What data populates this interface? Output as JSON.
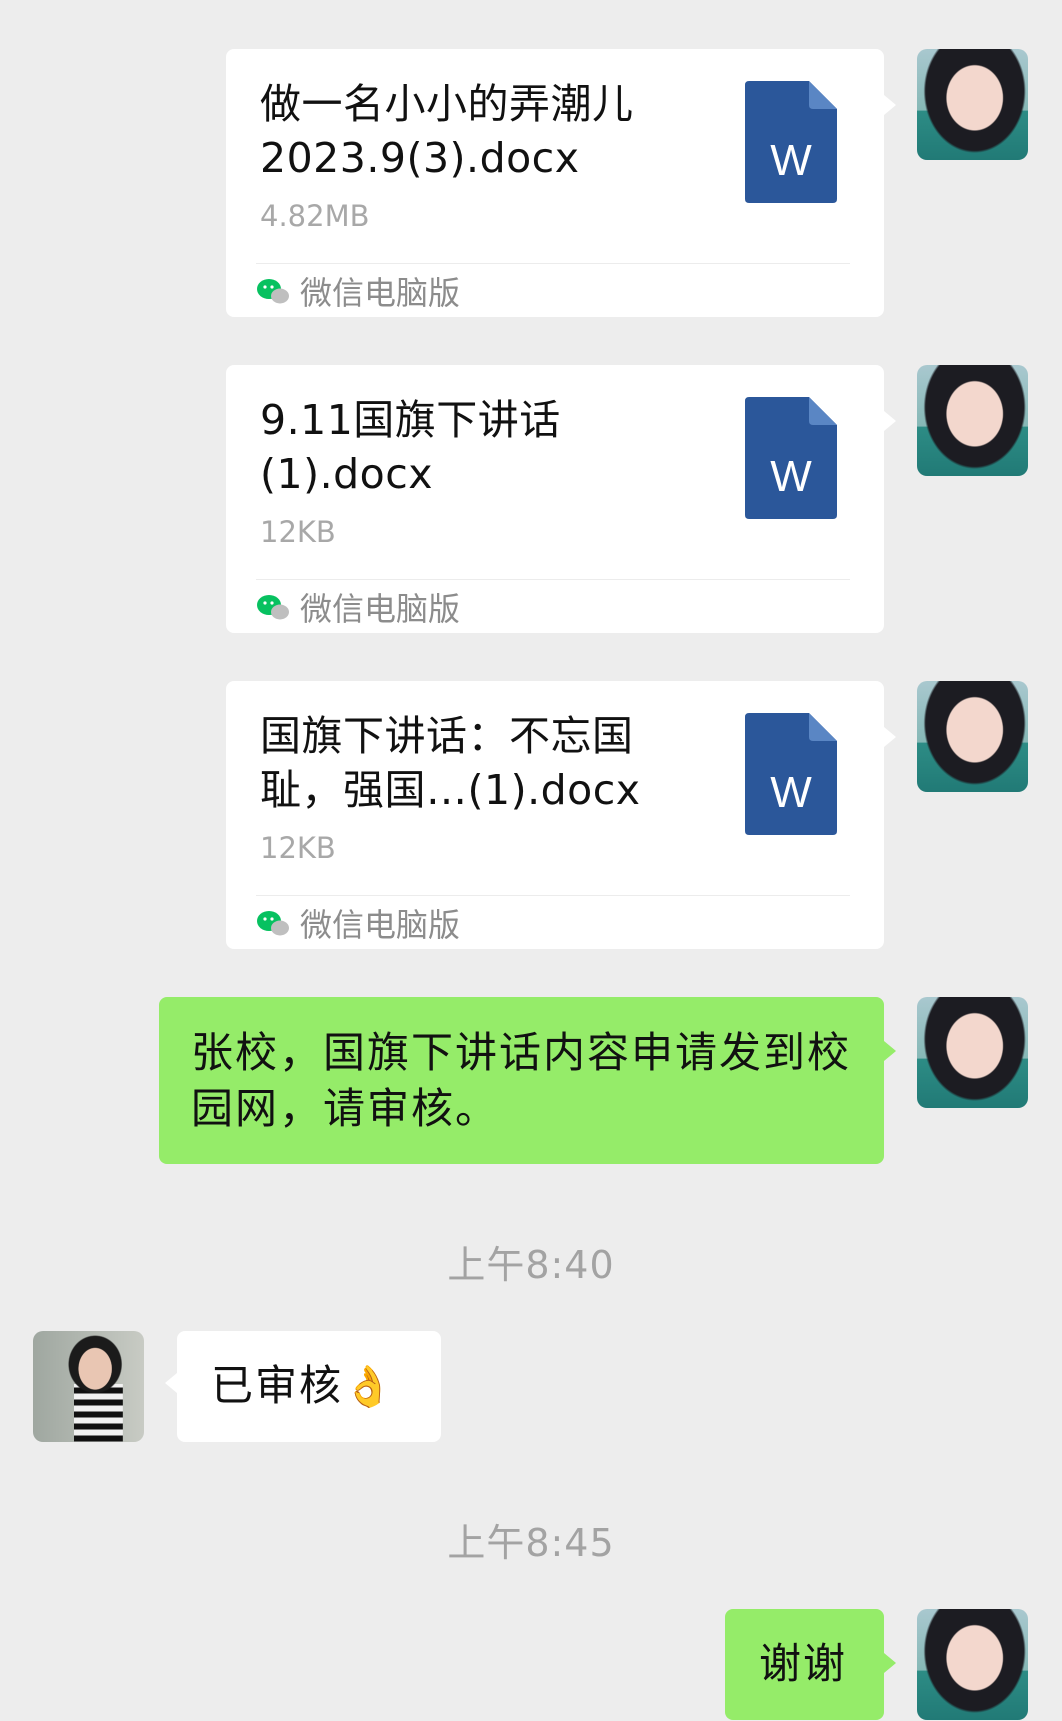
{
  "messages": [
    {
      "file_name": "做一名小小的弄潮儿2023.9(3).docx",
      "file_size": "4.82MB",
      "source": "微信电脑版",
      "icon": "word-docx-icon"
    },
    {
      "file_name": "9.11国旗下讲话(1).docx",
      "file_size": "12KB",
      "source": "微信电脑版",
      "icon": "word-docx-icon"
    },
    {
      "file_name": "国旗下讲话：不忘国耻，强国…(1).docx",
      "file_size": "12KB",
      "source": "微信电脑版",
      "icon": "word-docx-icon"
    },
    {
      "text": "张校，国旗下讲话内容申请发到校园网，请审核。"
    },
    {
      "time": "上午8:40"
    },
    {
      "text": "已审核",
      "emoji": "👌"
    },
    {
      "time": "上午8:45"
    },
    {
      "text": "谢谢"
    }
  ],
  "colors": {
    "background": "#ededed",
    "sent_bubble": "#95ec69",
    "received_bubble": "#ffffff",
    "word_blue": "#2b579a",
    "wechat_green": "#07c160"
  },
  "word_icon_letter": "W"
}
